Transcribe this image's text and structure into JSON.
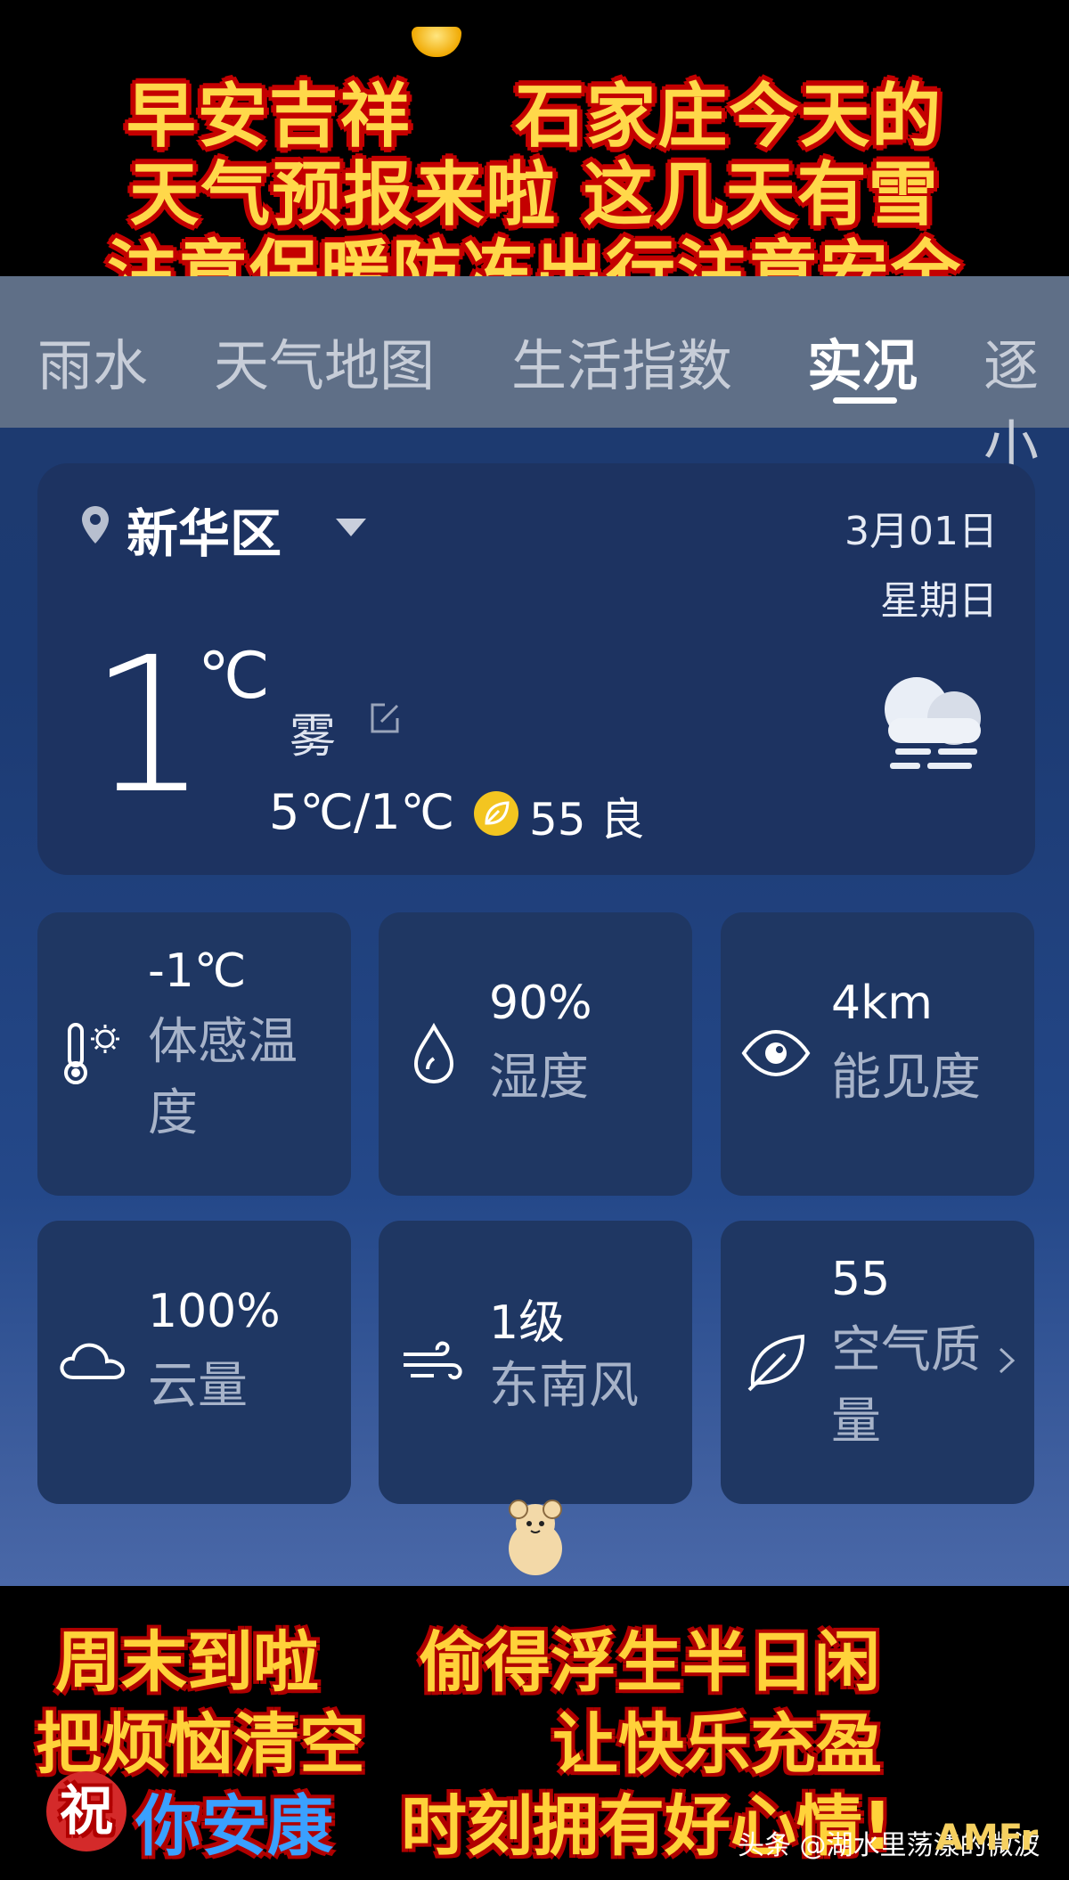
{
  "top_banner": {
    "line1": "早安吉祥    石家庄今天的",
    "line2": "天气预报来啦 这几天有雪",
    "line3": "注意保暖防冻出行注意安全"
  },
  "tabs": [
    {
      "label": "雨水"
    },
    {
      "label": "天气地图"
    },
    {
      "label": "生活指数"
    },
    {
      "label": "实况",
      "active": true
    },
    {
      "label": "逐小"
    }
  ],
  "current": {
    "location": "新华区",
    "date": "3月01日",
    "weekday": "星期日",
    "temperature": "1",
    "unit": "℃",
    "condition": "雾",
    "range": "5℃/1℃",
    "aqi": "55 良",
    "icon": "fog-icon"
  },
  "tiles": [
    {
      "value": "-1℃",
      "label": "体感温度",
      "icon": "thermometer-sun-icon"
    },
    {
      "value": "90%",
      "label": "湿度",
      "icon": "water-drop-icon"
    },
    {
      "value": "4km",
      "label": "能见度",
      "icon": "eye-icon"
    },
    {
      "value": "100%",
      "label": "云量",
      "icon": "cloud-icon"
    },
    {
      "value": "1级",
      "label": "东南风",
      "icon": "wind-icon"
    },
    {
      "value": "55",
      "label": "空气质量",
      "icon": "leaf-icon"
    }
  ],
  "bottom_banner": {
    "line1a": "周末到啦",
    "line1b": "偷得浮生半日闲",
    "line2a": "把烦恼清空",
    "line2b": "让快乐充盈",
    "blessing_char": "祝",
    "line3a": "你安康",
    "line3b": "时刻拥有好心情!"
  },
  "watermark": "头条 @湖水里荡漾的微波",
  "corner_text": "AMFr",
  "colors": {
    "banner_yellow": "#ffd84a",
    "banner_red": "#c40000",
    "card_bg": "#1d3361",
    "tab_bg": "#5f6f87",
    "aqi_yellow": "#f3c520"
  }
}
